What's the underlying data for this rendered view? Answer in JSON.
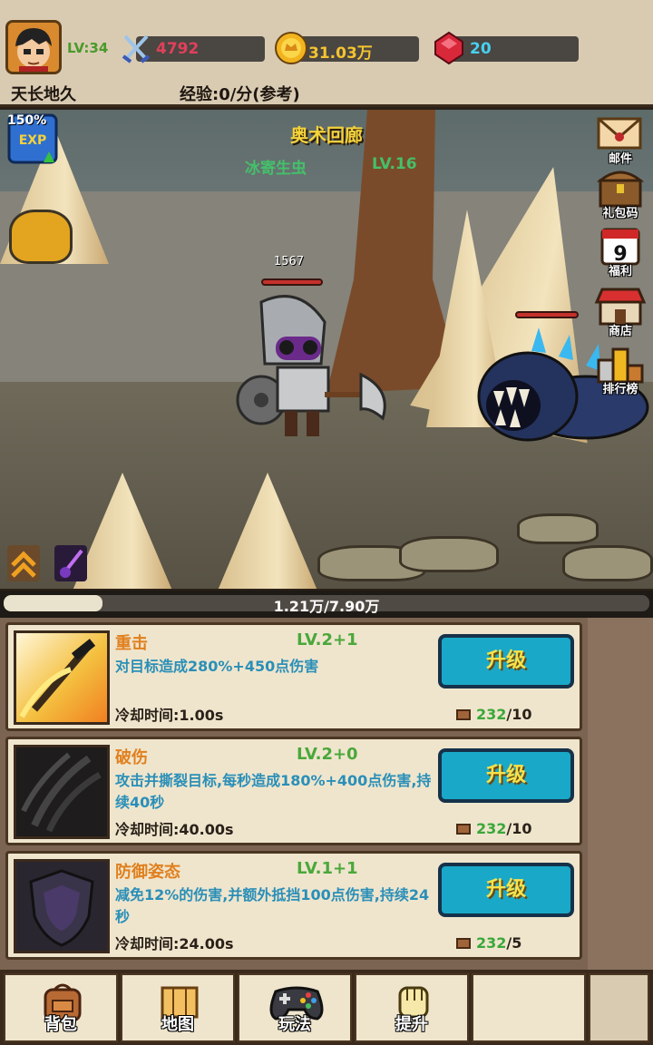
{
  "player": {
    "level": "LV:34",
    "name": "天长地久",
    "exp_rate": "经验:0/分(参考)"
  },
  "stats": {
    "combat_power": "4792",
    "gold": "31.03万",
    "gems": "20"
  },
  "scene": {
    "area_title": "奥术回廊",
    "enemy_name": "冰寄生虫",
    "enemy_level": "LV.16",
    "exp_boost": "150%",
    "player_hp": "1567",
    "player_hp_fraction": 1.0,
    "enemy_hp_fraction": 1.0
  },
  "side_menu": [
    {
      "label": "邮件",
      "icon": "mail-icon"
    },
    {
      "label": "礼包码",
      "icon": "gift-chest-icon"
    },
    {
      "label": "福利",
      "icon": "calendar-icon",
      "badge": "9"
    },
    {
      "label": "商店",
      "icon": "shop-icon"
    },
    {
      "label": "排行榜",
      "icon": "leaderboard-icon"
    }
  ],
  "progress": {
    "text": "1.21万/7.90万",
    "fraction": 0.153
  },
  "skills": [
    {
      "name": "重击",
      "level": "LV.2+1",
      "desc": "对目标造成280%+450点伤害",
      "cooldown": "冷却时间:1.00s",
      "button": "升级",
      "cost_have": "232",
      "cost_need": "/10"
    },
    {
      "name": "破伤",
      "level": "LV.2+0",
      "desc": "攻击并撕裂目标,每秒造成180%+400点伤害,持续40秒",
      "cooldown": "冷却时间:40.00s",
      "button": "升级",
      "cost_have": "232",
      "cost_need": "/10"
    },
    {
      "name": "防御姿态",
      "level": "LV.1+1",
      "desc": "减免12%的伤害,并额外抵挡100点伤害,持续24秒",
      "cooldown": "冷却时间:24.00s",
      "button": "升级",
      "cost_have": "232",
      "cost_need": "/5"
    }
  ],
  "bottom_nav": [
    {
      "label": "背包",
      "icon": "backpack-icon"
    },
    {
      "label": "地图",
      "icon": "map-scroll-icon"
    },
    {
      "label": "玩法",
      "icon": "gamepad-icon"
    },
    {
      "label": "提升",
      "icon": "fist-icon"
    }
  ],
  "colors": {
    "upgrade_button": "#1aa8c8",
    "upgrade_text": "#f7e24a",
    "skill_name": "#e0801e",
    "skill_level": "#4aa83a",
    "skill_desc": "#2a8fb8",
    "area_title": "#f4d23a",
    "enemy_name": "#45c06a"
  }
}
